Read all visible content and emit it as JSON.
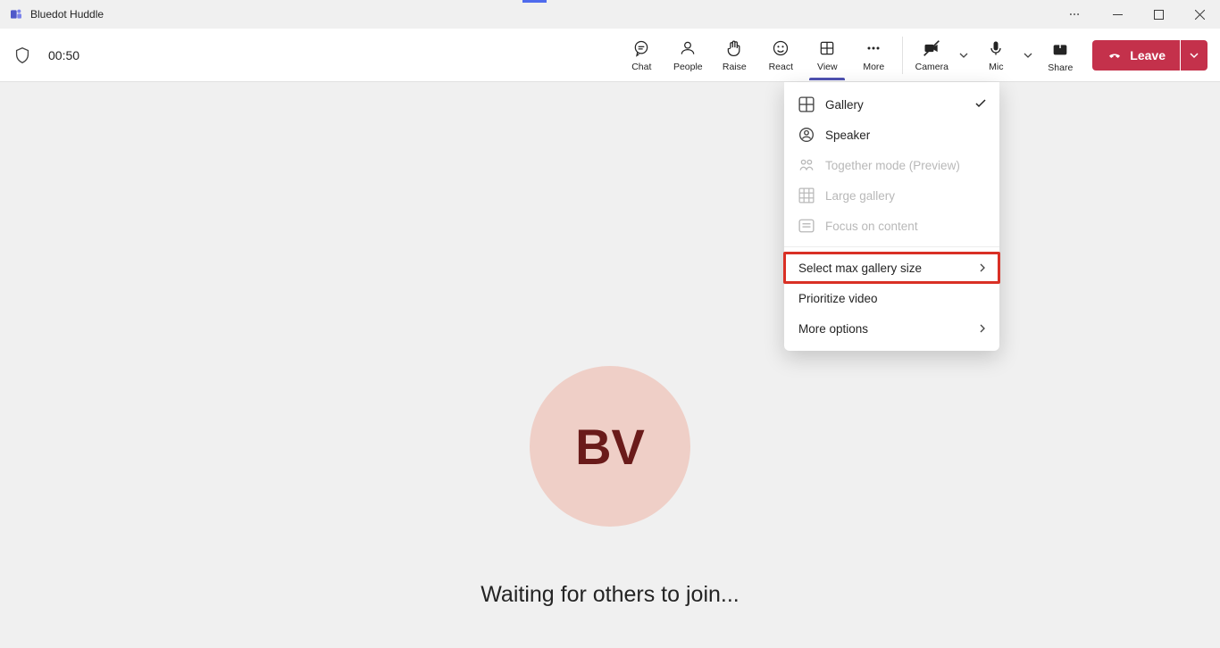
{
  "titlebar": {
    "app_name": "Bluedot Huddle"
  },
  "toolbar": {
    "timer": "00:50",
    "chat": "Chat",
    "people": "People",
    "raise": "Raise",
    "react": "React",
    "view": "View",
    "more": "More",
    "camera": "Camera",
    "mic": "Mic",
    "share": "Share",
    "leave": "Leave"
  },
  "stage": {
    "avatar_initials": "BV",
    "waiting_text": "Waiting for others to join..."
  },
  "dropdown": {
    "gallery": "Gallery",
    "speaker": "Speaker",
    "together": "Together mode (Preview)",
    "large_gallery": "Large gallery",
    "focus_content": "Focus on content",
    "max_gallery": "Select max gallery size",
    "prioritize": "Prioritize video",
    "more_options": "More options"
  }
}
